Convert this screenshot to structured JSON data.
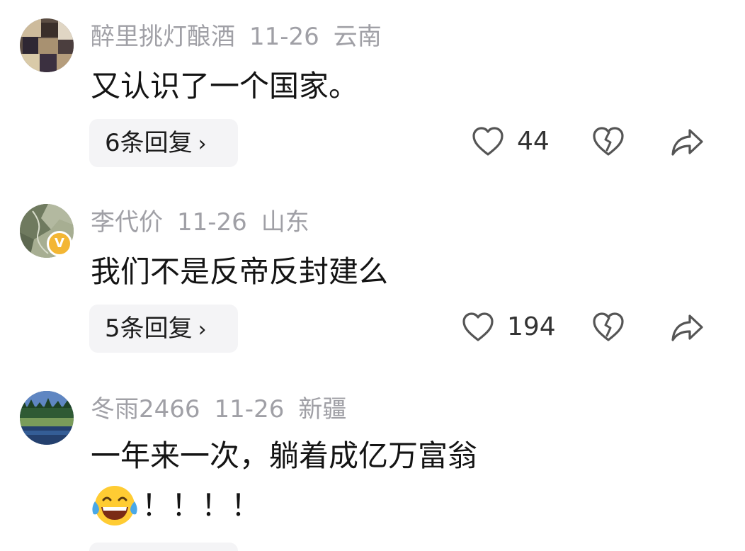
{
  "comments": [
    {
      "username": "醉里挑灯酿酒",
      "date": "11-26",
      "location": "云南",
      "text": "又认识了一个国家。",
      "replies_label": "6条回复",
      "likes": "44"
    },
    {
      "username": "李代价",
      "date": "11-26",
      "location": "山东",
      "text": "我们不是反帝反封建么",
      "replies_label": "5条回复",
      "likes": "194",
      "badge": "V"
    },
    {
      "username": "冬雨2466",
      "date": "11-26",
      "location": "新疆",
      "text": "一年来一次，躺着成亿万富翁",
      "text_line2": "！！！！",
      "emoji": "laughing-tears-emoji"
    }
  ],
  "icons": {
    "chevron": "›",
    "like": "heart-outline-icon",
    "dislike": "broken-heart-icon",
    "share": "share-arrow-icon"
  },
  "colors": {
    "meta": "#a0a0a6",
    "text": "#141414",
    "reply_bg": "#f4f4f6",
    "icon": "#555555",
    "badge": "#f3b634"
  }
}
